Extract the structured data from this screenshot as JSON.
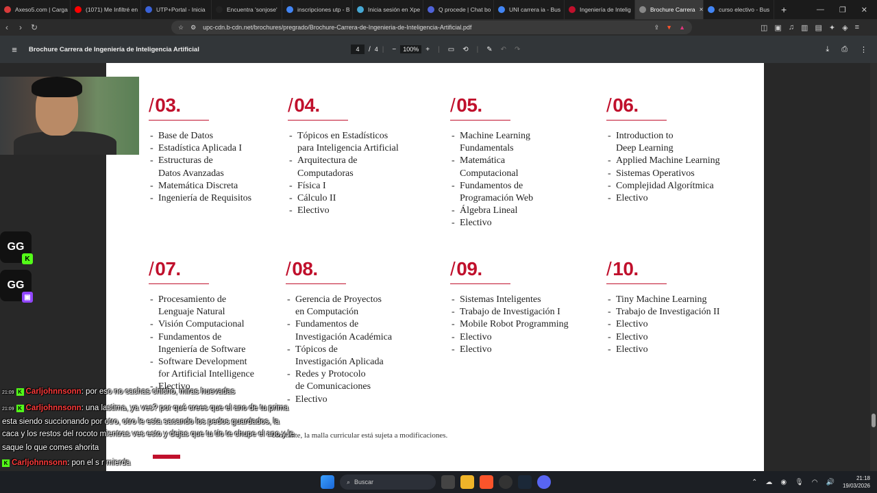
{
  "tabs": [
    {
      "label": "Axeso5.com | Carga",
      "color": "#d83b3b"
    },
    {
      "label": "(1071) Me Infiltré en",
      "color": "#ff0000"
    },
    {
      "label": "UTP+Portal - Inicia",
      "color": "#3a62d8"
    },
    {
      "label": "Encuentra 'sonjose'",
      "color": "#222222"
    },
    {
      "label": "inscripciones utp - B",
      "color": "#4285f4"
    },
    {
      "label": "Inicia sesión en Xpe",
      "color": "#46a8d4"
    },
    {
      "label": "Q procede | Chat bo",
      "color": "#4f63d8"
    },
    {
      "label": "UNI carrera ia - Bus",
      "color": "#4285f4"
    },
    {
      "label": "Ingeniería de Intelig",
      "color": "#c0102c"
    },
    {
      "label": "Brochure Carrera",
      "color": "#888888",
      "active": true
    },
    {
      "label": "curso electivo - Bus",
      "color": "#4285f4"
    }
  ],
  "browser": {
    "url": "upc-cdn.b-cdn.net/brochures/pregrado/Brochure-Carrera-de-Ingenieria-de-Inteligencia-Artificial.pdf"
  },
  "pdf": {
    "title": "Brochure Carrera de Ingeniería de Inteligencia Artificial",
    "page_current": "4",
    "page_total": "4",
    "zoom": "100%"
  },
  "semesters": [
    {
      "num": "03.",
      "items": [
        "Base de Datos",
        "Estadística Aplicada I",
        "Estructuras de\nDatos Avanzadas",
        "Matemática Discreta",
        "Ingeniería de Requisitos"
      ]
    },
    {
      "num": "04.",
      "items": [
        "Tópicos en Estadísticos\npara Inteligencia Artificial",
        "Arquitectura de\nComputadoras",
        "Física I",
        "Cálculo II",
        "Electivo"
      ]
    },
    {
      "num": "05.",
      "items": [
        "Machine Learning\nFundamentals",
        "Matemática\nComputacional",
        "Fundamentos de\nProgramación Web",
        "Álgebra Lineal",
        "Electivo"
      ]
    },
    {
      "num": "06.",
      "items": [
        "Introduction to\nDeep Learning",
        "Applied Machine Learning",
        "Sistemas Operativos",
        "Complejidad Algorítmica",
        "Electivo"
      ]
    },
    {
      "num": "07.",
      "items": [
        "Procesamiento de\nLenguaje Natural",
        "Visión Computacional",
        "Fundamentos de\nIngeniería de Software",
        "Software Development\nfor Artificial Intelligence",
        "Electivo"
      ]
    },
    {
      "num": "08.",
      "items": [
        "Gerencia de Proyectos\nen Computación",
        "Fundamentos de\nInvestigación Académica",
        "Tópicos de\nInvestigación Aplicada",
        "Redes y Protocolo\nde Comunicaciones",
        "Electivo"
      ]
    },
    {
      "num": "09.",
      "items": [
        "Sistemas Inteligentes",
        "Trabajo de Investigación I",
        "Mobile Robot Programming",
        "Electivo",
        "Electivo"
      ]
    },
    {
      "num": "10.",
      "items": [
        "Tiny Machine Learning",
        "Trabajo de Investigación II",
        "Electivo",
        "Electivo",
        "Electivo"
      ]
    }
  ],
  "footnote": "...la malla curricular está sujeta a modificaciones.",
  "footnote_visible": "constante, la malla curricular está sujeta a modificaciones.",
  "chat": [
    {
      "time": "21:09",
      "user": "Carljohnnsonn",
      "text": ": por eso no cachas chicho, miras huevadas"
    },
    {
      "time": "21:09",
      "user": "Carljohnnsonn",
      "text": ": una lastima, ya ves? por qué crees que el ano de tu prima"
    },
    {
      "time": "",
      "user": "",
      "text": "esta siendo succionando por otro, otro le esta sacando los pedos guardados, la"
    },
    {
      "time": "",
      "user": "",
      "text": "caca y los restos del rocoto mientras ves esto y dejas que tu tío te chupe el ano y le"
    },
    {
      "time": "",
      "user": "",
      "text": "saque lo que comes ahorita"
    },
    {
      "time": "",
      "user": "Carljohnnsonn",
      "text": ": pon el s r mierda"
    },
    {
      "time": "",
      "user": "thelega12",
      "text": ": que fue chicho"
    }
  ],
  "taskbar": {
    "search": "Buscar",
    "time": "21:18",
    "date": "19/03/2026"
  },
  "colors": {
    "accent": "#c0102c",
    "viewer_bg": "#282828",
    "toolbar": "#323639"
  }
}
